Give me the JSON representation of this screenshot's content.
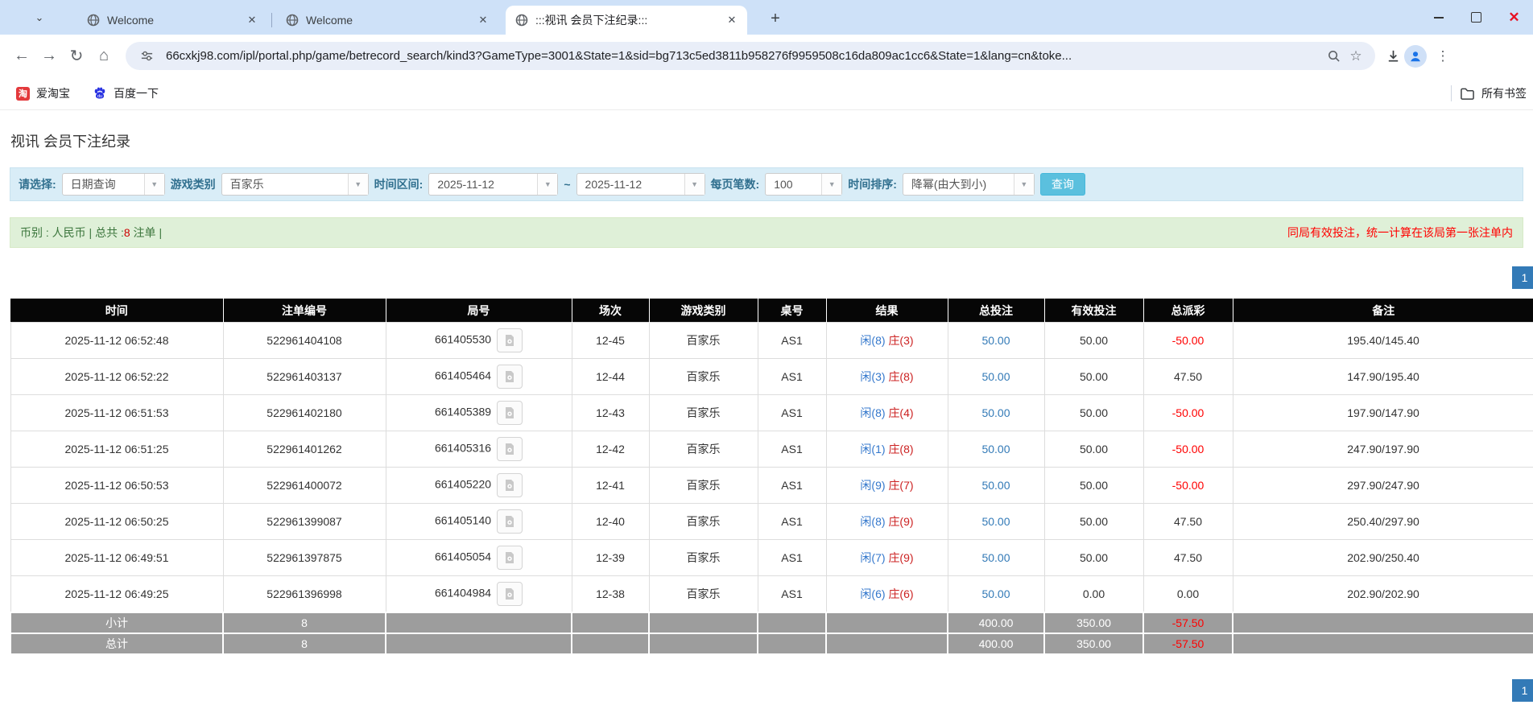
{
  "browser": {
    "tabs": [
      {
        "title": "Welcome"
      },
      {
        "title": "Welcome"
      },
      {
        "title": ":::视讯 会员下注纪录:::"
      }
    ],
    "url": "66cxkj98.com/ipl/portal.php/game/betrecord_search/kind3?GameType=3001&State=1&sid=bg713c5ed3811b958276f9959508c16da809ac1cc6&State=1&lang=cn&toke...",
    "bookmarks": {
      "taobao": "爱淘宝",
      "baidu": "百度一下",
      "all_bookmarks": "所有书签"
    }
  },
  "page": {
    "title": "视讯 会员下注纪录",
    "filters": {
      "select_label": "请选择:",
      "select_value": "日期查询",
      "game_type_label": "游戏类别",
      "game_type_value": "百家乐",
      "date_range_label": "时间区间:",
      "date_from": "2025-11-12",
      "date_separator": "~",
      "date_to": "2025-11-12",
      "page_size_label": "每页笔数:",
      "page_size_value": "100",
      "sort_label": "时间排序:",
      "sort_value": "降幂(由大到小)",
      "search_button": "查询"
    },
    "info_bar": {
      "left_prefix": "币别 : 人民币 | 总共 :",
      "count": "8",
      "left_suffix": " 注单 |",
      "right_notice": "同局有效投注，统一计算在该局第一张注单内"
    },
    "pagination": {
      "current": "1"
    },
    "table": {
      "headers": [
        "时间",
        "注单编号",
        "局号",
        "场次",
        "游戏类别",
        "桌号",
        "结果",
        "总投注",
        "有效投注",
        "总派彩",
        "备注"
      ],
      "rows": [
        {
          "time": "2025-11-12 06:52:48",
          "bet_id": "522961404108",
          "round": "661405530",
          "session": "12-45",
          "game": "百家乐",
          "table_no": "AS1",
          "result_player": "闲(8)",
          "result_banker": "庄(3)",
          "total_bet": "50.00",
          "valid_bet": "50.00",
          "payout": "-50.00",
          "remark": "195.40/145.40"
        },
        {
          "time": "2025-11-12 06:52:22",
          "bet_id": "522961403137",
          "round": "661405464",
          "session": "12-44",
          "game": "百家乐",
          "table_no": "AS1",
          "result_player": "闲(3)",
          "result_banker": "庄(8)",
          "total_bet": "50.00",
          "valid_bet": "50.00",
          "payout": "47.50",
          "remark": "147.90/195.40"
        },
        {
          "time": "2025-11-12 06:51:53",
          "bet_id": "522961402180",
          "round": "661405389",
          "session": "12-43",
          "game": "百家乐",
          "table_no": "AS1",
          "result_player": "闲(8)",
          "result_banker": "庄(4)",
          "total_bet": "50.00",
          "valid_bet": "50.00",
          "payout": "-50.00",
          "remark": "197.90/147.90"
        },
        {
          "time": "2025-11-12 06:51:25",
          "bet_id": "522961401262",
          "round": "661405316",
          "session": "12-42",
          "game": "百家乐",
          "table_no": "AS1",
          "result_player": "闲(1)",
          "result_banker": "庄(8)",
          "total_bet": "50.00",
          "valid_bet": "50.00",
          "payout": "-50.00",
          "remark": "247.90/197.90"
        },
        {
          "time": "2025-11-12 06:50:53",
          "bet_id": "522961400072",
          "round": "661405220",
          "session": "12-41",
          "game": "百家乐",
          "table_no": "AS1",
          "result_player": "闲(9)",
          "result_banker": "庄(7)",
          "total_bet": "50.00",
          "valid_bet": "50.00",
          "payout": "-50.00",
          "remark": "297.90/247.90"
        },
        {
          "time": "2025-11-12 06:50:25",
          "bet_id": "522961399087",
          "round": "661405140",
          "session": "12-40",
          "game": "百家乐",
          "table_no": "AS1",
          "result_player": "闲(8)",
          "result_banker": "庄(9)",
          "total_bet": "50.00",
          "valid_bet": "50.00",
          "payout": "47.50",
          "remark": "250.40/297.90"
        },
        {
          "time": "2025-11-12 06:49:51",
          "bet_id": "522961397875",
          "round": "661405054",
          "session": "12-39",
          "game": "百家乐",
          "table_no": "AS1",
          "result_player": "闲(7)",
          "result_banker": "庄(9)",
          "total_bet": "50.00",
          "valid_bet": "50.00",
          "payout": "47.50",
          "remark": "202.90/250.40"
        },
        {
          "time": "2025-11-12 06:49:25",
          "bet_id": "522961396998",
          "round": "661404984",
          "session": "12-38",
          "game": "百家乐",
          "table_no": "AS1",
          "result_player": "闲(6)",
          "result_banker": "庄(6)",
          "total_bet": "50.00",
          "valid_bet": "0.00",
          "payout": "0.00",
          "remark": "202.90/202.90"
        }
      ],
      "subtotal": {
        "label": "小计",
        "count": "8",
        "total_bet": "400.00",
        "valid_bet": "350.00",
        "payout": "-57.50"
      },
      "total": {
        "label": "总计",
        "count": "8",
        "total_bet": "400.00",
        "valid_bet": "350.00",
        "payout": "-57.50"
      }
    }
  },
  "colors": {
    "tabstrip_bg": "#cee1f8",
    "filter_bg": "#d9edf7",
    "info_bg": "#dff0d8",
    "header_bg": "#060606",
    "totals_bg": "#9d9d9d",
    "link_blue": "#337ab7",
    "player_blue": "#3377cc",
    "banker_red": "#cc2222",
    "negative_red": "#ff0000",
    "search_button_teal": "#5bc0de"
  }
}
